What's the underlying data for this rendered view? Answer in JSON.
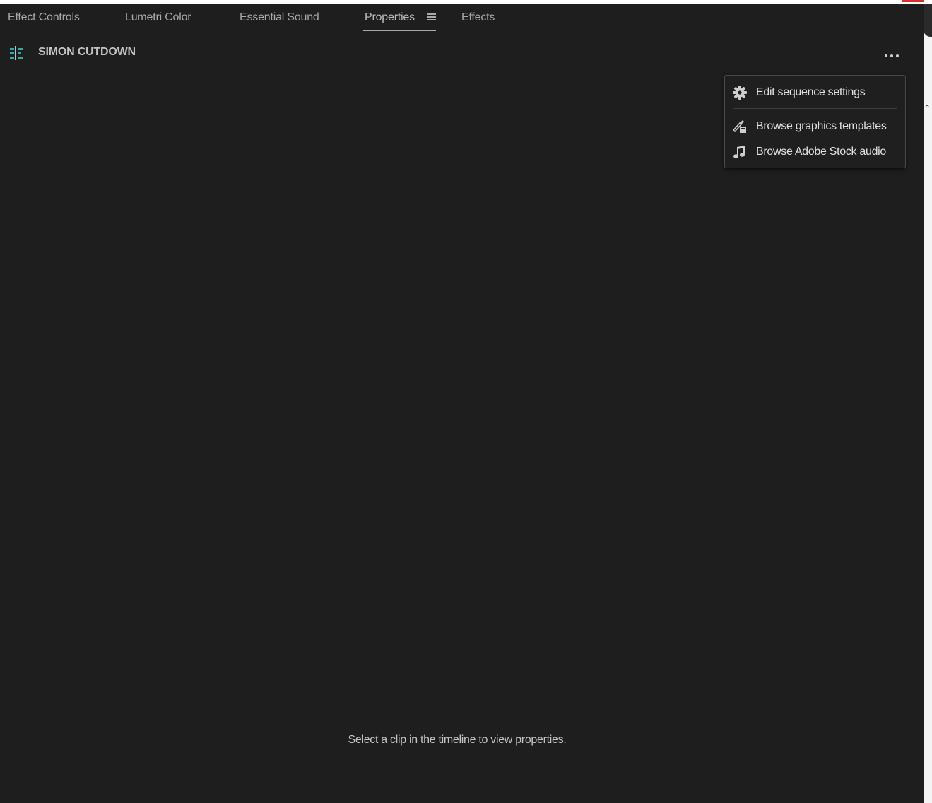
{
  "tabs": [
    {
      "label": "Effect Controls",
      "active": false
    },
    {
      "label": "Lumetri Color",
      "active": false
    },
    {
      "label": "Essential Sound",
      "active": false
    },
    {
      "label": "Properties",
      "active": true
    },
    {
      "label": "Effects",
      "active": false
    }
  ],
  "panel_menu_icon": "hamburger-menu-icon",
  "sequence": {
    "icon": "sequence-icon",
    "name": "SIMON CUTDOWN"
  },
  "more_button_icon": "more-options-icon",
  "context_menu": {
    "items": [
      {
        "icon": "gear-icon",
        "label": "Edit sequence settings"
      },
      {
        "icon": "graphics-template-icon",
        "label": "Browse graphics templates"
      },
      {
        "icon": "music-note-icon",
        "label": "Browse Adobe Stock audio"
      }
    ]
  },
  "empty_state": {
    "message": "Select a clip in the timeline to view properties."
  },
  "colors": {
    "panel_bg": "#1e1e1e",
    "text": "#a9a9a9",
    "menu_text": "#e2e2e2",
    "sequence_icon_accent": "#3aa6a0"
  }
}
